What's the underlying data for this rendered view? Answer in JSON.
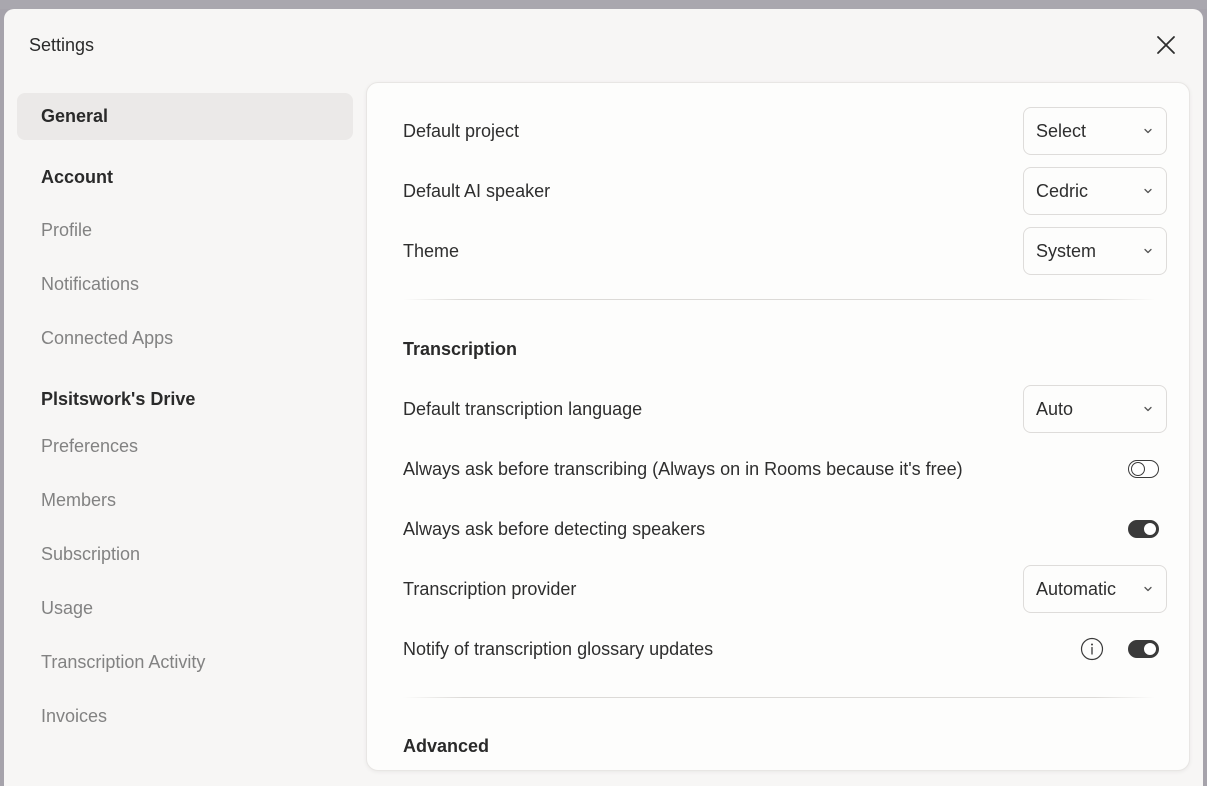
{
  "modal": {
    "title": "Settings"
  },
  "sidebar": {
    "active": "General",
    "items": [
      {
        "label": "General"
      },
      {
        "label": "Profile"
      },
      {
        "label": "Notifications"
      },
      {
        "label": "Connected Apps"
      },
      {
        "label": "Preferences"
      },
      {
        "label": "Members"
      },
      {
        "label": "Subscription"
      },
      {
        "label": "Usage"
      },
      {
        "label": "Transcription Activity"
      },
      {
        "label": "Invoices"
      }
    ],
    "headings": {
      "account": "Account",
      "drive": "Plsitswork's Drive"
    }
  },
  "general": {
    "default_project": {
      "label": "Default project",
      "value": "Select"
    },
    "default_ai_speaker": {
      "label": "Default AI speaker",
      "value": "Cedric"
    },
    "theme": {
      "label": "Theme",
      "value": "System"
    }
  },
  "transcription": {
    "title": "Transcription",
    "language": {
      "label": "Default transcription language",
      "value": "Auto"
    },
    "ask_before_transcribing": {
      "label": "Always ask before transcribing (Always on in Rooms because it's free)",
      "enabled": false
    },
    "ask_before_detecting": {
      "label": "Always ask before detecting speakers",
      "enabled": true
    },
    "provider": {
      "label": "Transcription provider",
      "value": "Automatic"
    },
    "glossary_updates": {
      "label": "Notify of transcription glossary updates",
      "enabled": true
    }
  },
  "advanced": {
    "title": "Advanced"
  },
  "icons": {
    "close": "close-icon",
    "chevron": "chevron-down-icon",
    "info": "info-icon"
  }
}
